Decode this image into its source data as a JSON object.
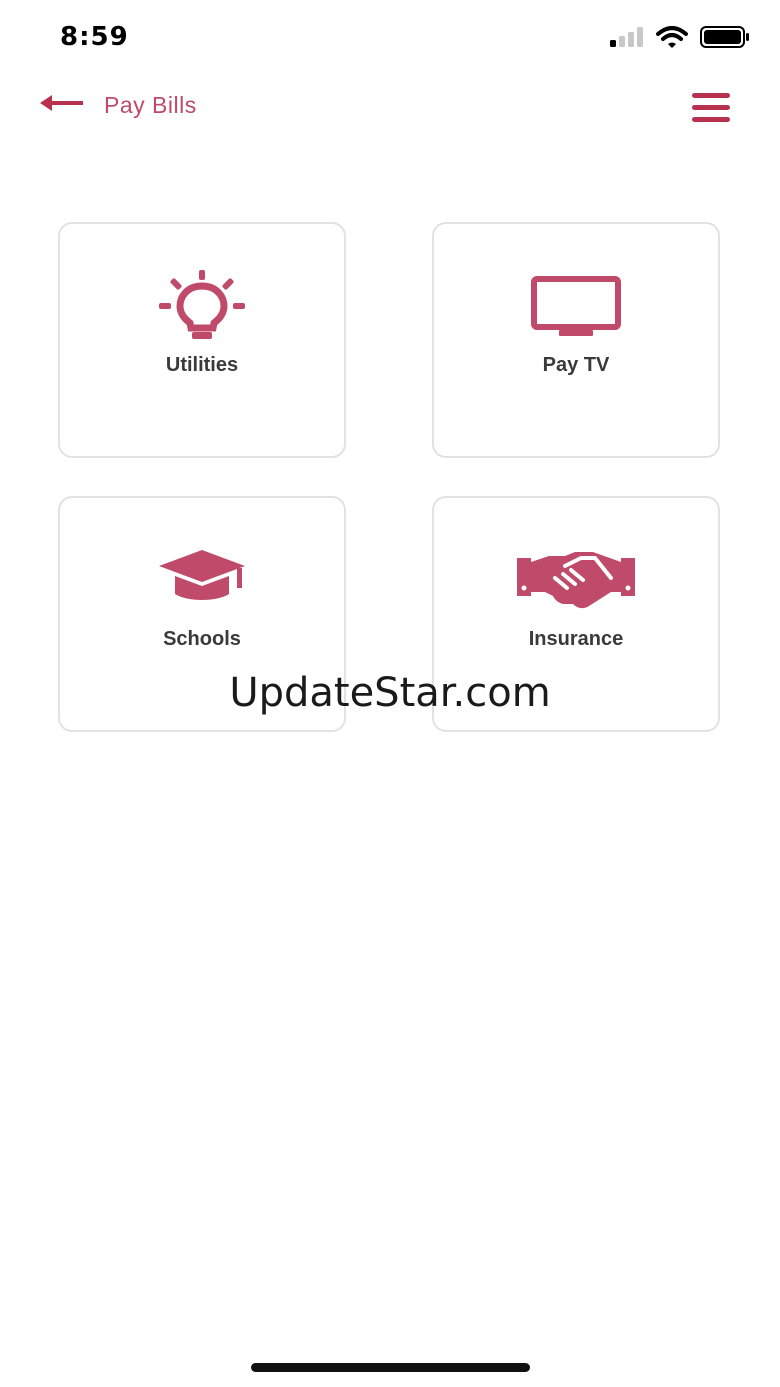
{
  "status_bar": {
    "time": "8:59"
  },
  "nav": {
    "title": "Pay Bills"
  },
  "categories": [
    {
      "label": "Utilities",
      "icon": "lightbulb-icon"
    },
    {
      "label": "Pay TV",
      "icon": "tv-icon"
    },
    {
      "label": "Schools",
      "icon": "graduation-cap-icon"
    },
    {
      "label": "Insurance",
      "icon": "handshake-icon"
    }
  ],
  "watermark": "UpdateStar.com",
  "colors": {
    "accent": "#c04a6a",
    "nav_accent": "#b8324f",
    "card_border": "#e2e2e2",
    "label_text": "#3a3a3a"
  }
}
